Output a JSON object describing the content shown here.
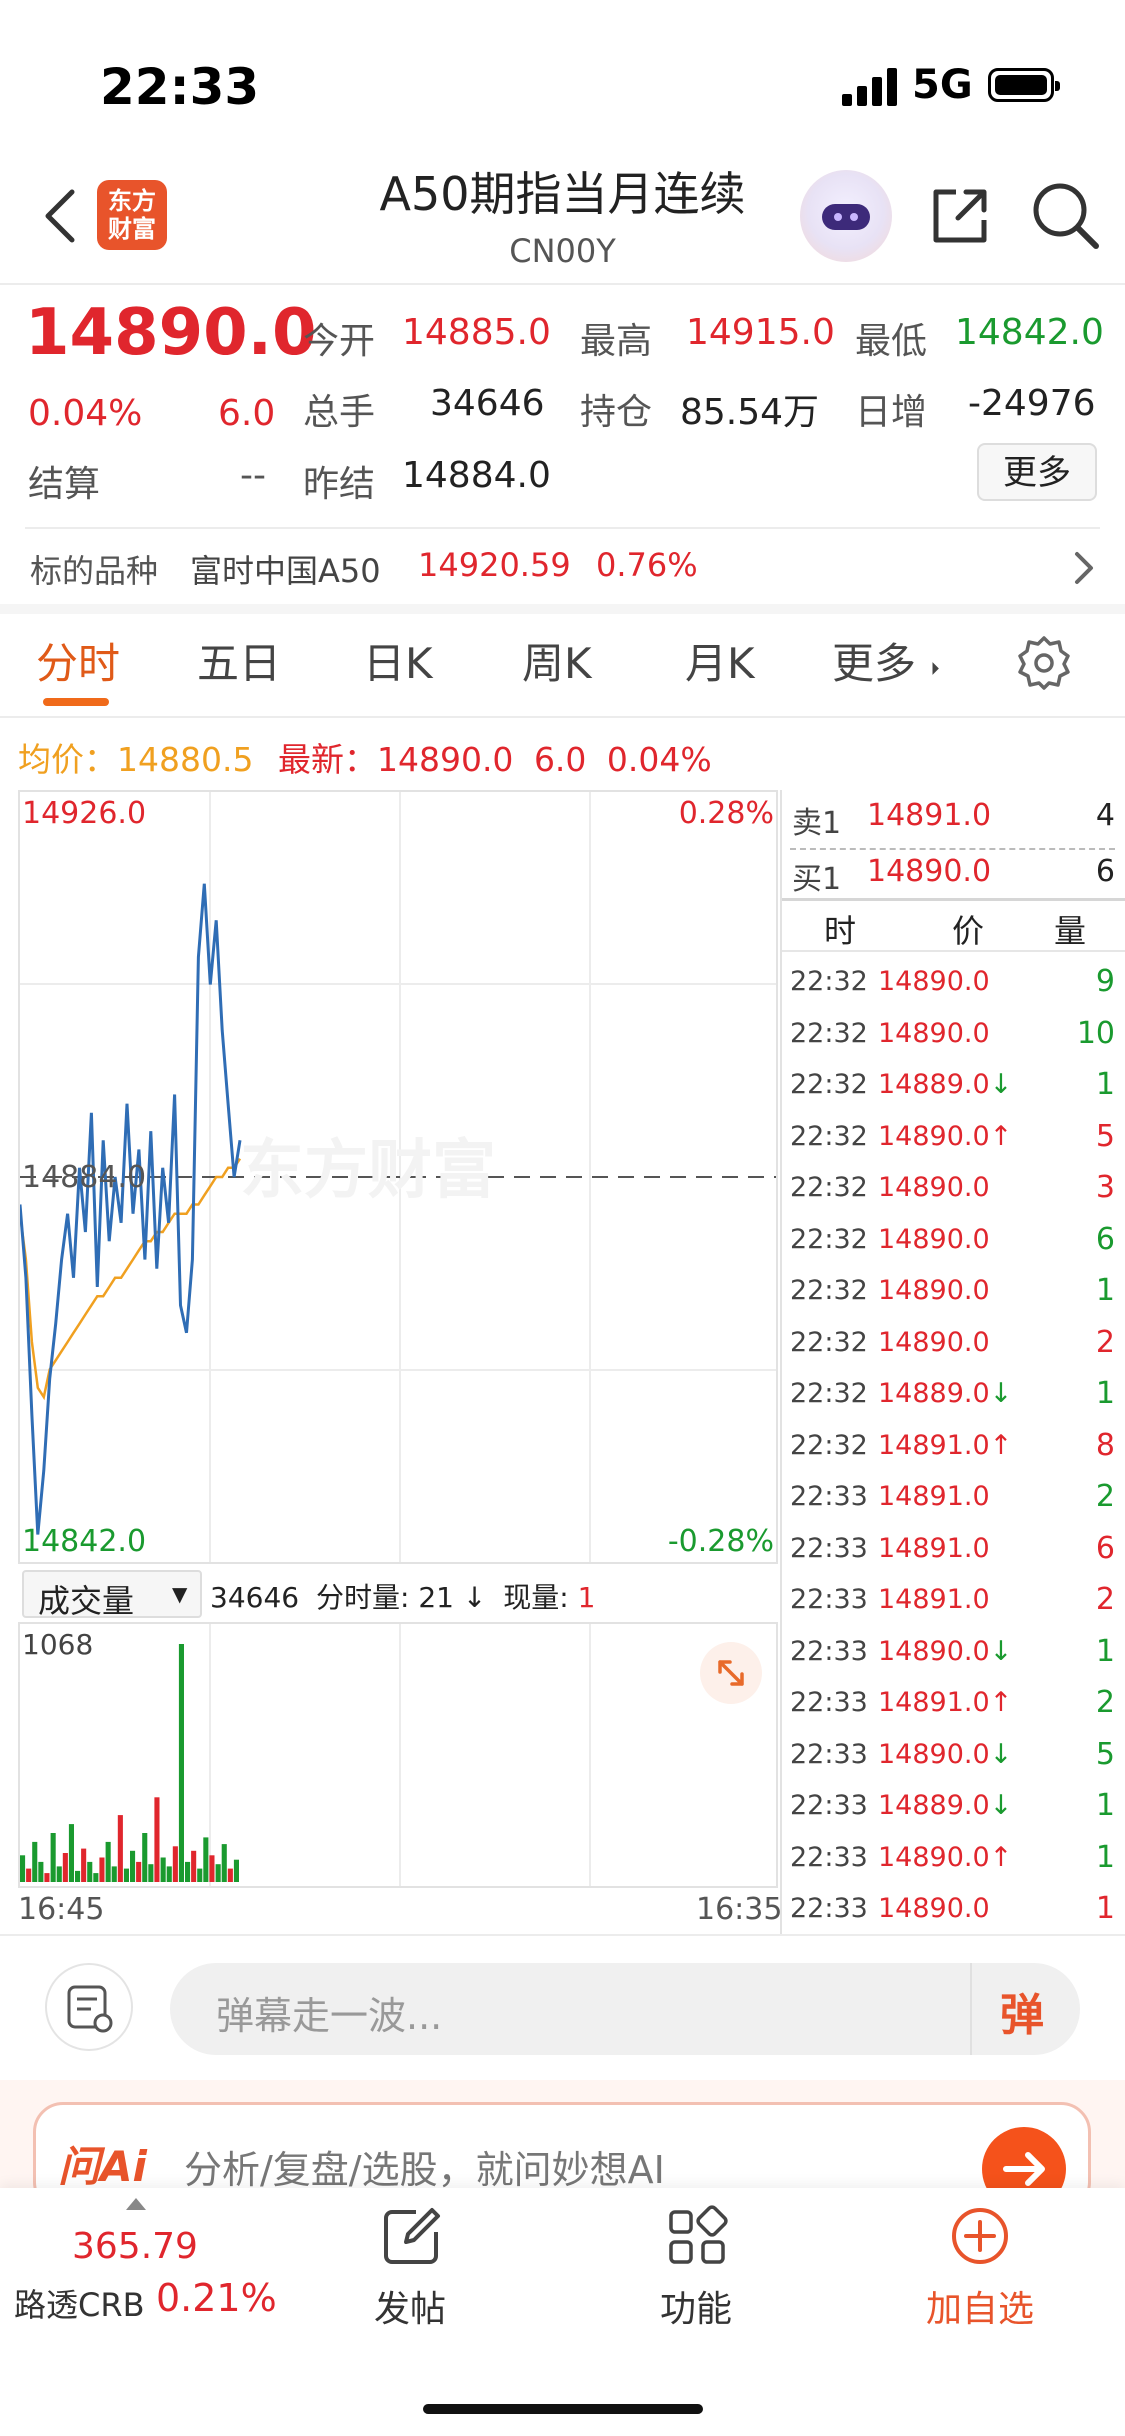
{
  "status_bar": {
    "time": "22:33",
    "network": "5G"
  },
  "header": {
    "logo_text": "东方财富",
    "title": "A50期指当月连续",
    "code": "CN00Y"
  },
  "quote": {
    "price": "14890.0",
    "change_pct": "0.04%",
    "change": "6.0",
    "fields": [
      {
        "label": "今开",
        "value": "14885.0"
      },
      {
        "label": "最高",
        "value": "14915.0"
      },
      {
        "label": "最低",
        "value": "14842.0"
      },
      {
        "label": "总手",
        "value": "34646"
      },
      {
        "label": "持仓",
        "value": "85.54万"
      },
      {
        "label": "日增",
        "value": "-24976"
      },
      {
        "label": "结算",
        "value": "--"
      },
      {
        "label": "昨结",
        "value": "14884.0"
      }
    ],
    "more_button": "更多"
  },
  "underlying": {
    "label": "标的品种",
    "name": "富时中国A50",
    "price": "14920.59",
    "pct": "0.76%"
  },
  "tabs": [
    "分时",
    "五日",
    "日K",
    "周K",
    "月K",
    "更多"
  ],
  "avg_line": {
    "avg_label": "均价：",
    "avg_value": "14880.5",
    "latest_label": "最新：",
    "latest_value": "14890.0",
    "change": "6.0",
    "pct": "0.04%"
  },
  "chart_data": {
    "type": "line",
    "ylim": [
      14842.0,
      14926.0
    ],
    "y_top_label": "14926.0",
    "y_bottom_label": "14842.0",
    "y_mid_label": "14884.0",
    "pct_top": "0.28%",
    "pct_bottom": "-0.28%",
    "x_start_label": "16:45",
    "x_end_label": "16:35",
    "watermark": "东方财富",
    "series": [
      {
        "values": [
          14881,
          14873,
          14858,
          14845,
          14852,
          14862,
          14868,
          14875,
          14880,
          14873,
          14885,
          14878,
          14891,
          14872,
          14888,
          14877,
          14884,
          14879,
          14892,
          14880,
          14887,
          14875,
          14889,
          14874,
          14885,
          14879,
          14893,
          14870,
          14867,
          14875,
          14908,
          14916,
          14905,
          14912,
          14900,
          14892,
          14884,
          14888
        ]
      },
      {
        "values": [
          14880,
          14875,
          14866,
          14861,
          14860,
          14863,
          14864,
          14865,
          14866,
          14867,
          14868,
          14869,
          14870,
          14871,
          14871,
          14872,
          14873,
          14873,
          14874,
          14875,
          14876,
          14877,
          14877,
          14878,
          14878,
          14879,
          14880,
          14880,
          14880,
          14881,
          14881,
          14882,
          14883,
          14884,
          14884,
          14885,
          14885,
          14886
        ]
      }
    ]
  },
  "order_book": {
    "sell_label": "卖1",
    "sell_price": "14891.0",
    "sell_qty": "4",
    "buy_label": "买1",
    "buy_price": "14890.0",
    "buy_qty": "6"
  },
  "ticks": {
    "headers": [
      "时",
      "价",
      "量"
    ],
    "rows": [
      {
        "time": "22:32",
        "price": "14890.0",
        "arrow": "",
        "qty": "9",
        "qty_color": "green"
      },
      {
        "time": "22:32",
        "price": "14890.0",
        "arrow": "",
        "qty": "10",
        "qty_color": "green"
      },
      {
        "time": "22:32",
        "price": "14889.0",
        "arrow": "↓",
        "qty": "1",
        "qty_color": "green"
      },
      {
        "time": "22:32",
        "price": "14890.0",
        "arrow": "↑",
        "qty": "5",
        "qty_color": "red"
      },
      {
        "time": "22:32",
        "price": "14890.0",
        "arrow": "",
        "qty": "3",
        "qty_color": "red"
      },
      {
        "time": "22:32",
        "price": "14890.0",
        "arrow": "",
        "qty": "6",
        "qty_color": "green"
      },
      {
        "time": "22:32",
        "price": "14890.0",
        "arrow": "",
        "qty": "1",
        "qty_color": "green"
      },
      {
        "time": "22:32",
        "price": "14890.0",
        "arrow": "",
        "qty": "2",
        "qty_color": "red"
      },
      {
        "time": "22:32",
        "price": "14889.0",
        "arrow": "↓",
        "qty": "1",
        "qty_color": "green"
      },
      {
        "time": "22:32",
        "price": "14891.0",
        "arrow": "↑",
        "qty": "8",
        "qty_color": "red"
      },
      {
        "time": "22:33",
        "price": "14891.0",
        "arrow": "",
        "qty": "2",
        "qty_color": "green"
      },
      {
        "time": "22:33",
        "price": "14891.0",
        "arrow": "",
        "qty": "6",
        "qty_color": "red"
      },
      {
        "time": "22:33",
        "price": "14891.0",
        "arrow": "",
        "qty": "2",
        "qty_color": "red"
      },
      {
        "time": "22:33",
        "price": "14890.0",
        "arrow": "↓",
        "qty": "1",
        "qty_color": "green"
      },
      {
        "time": "22:33",
        "price": "14891.0",
        "arrow": "↑",
        "qty": "2",
        "qty_color": "green"
      },
      {
        "time": "22:33",
        "price": "14890.0",
        "arrow": "↓",
        "qty": "5",
        "qty_color": "green"
      },
      {
        "time": "22:33",
        "price": "14889.0",
        "arrow": "↓",
        "qty": "1",
        "qty_color": "green"
      },
      {
        "time": "22:33",
        "price": "14890.0",
        "arrow": "↑",
        "qty": "1",
        "qty_color": "green"
      },
      {
        "time": "22:33",
        "price": "14890.0",
        "arrow": "",
        "qty": "1",
        "qty_color": "red"
      }
    ]
  },
  "volume": {
    "selector": "成交量",
    "total": "34646",
    "minute_label": "分时量:",
    "minute_value": "21 ↓",
    "now_label": "现量:",
    "now_value": "1",
    "max_label": "1068",
    "bars": [
      120,
      60,
      180,
      90,
      40,
      220,
      70,
      130,
      260,
      50,
      150,
      90,
      40,
      110,
      180,
      70,
      300,
      60,
      140,
      90,
      220,
      80,
      380,
      110,
      70,
      160,
      1068,
      90,
      140,
      60,
      200,
      120,
      80,
      170,
      60,
      100
    ]
  },
  "comment": {
    "placeholder": "弹幕走一波...",
    "danmu_button": "弹"
  },
  "ai": {
    "logo": "问Ai",
    "placeholder": "分析/复盘/选股，就问妙想AI"
  },
  "bottom_bar": {
    "ticker_value": "365.79",
    "ticker_name": "路透CRB",
    "ticker_pct": "0.21%",
    "items": [
      "发帖",
      "功能",
      "加自选"
    ]
  },
  "colors": {
    "up": "#e0262d",
    "down": "#1a9a2f",
    "accent": "#f06a1a",
    "price_line": "#2f6db5",
    "avg_line": "#f0a020"
  }
}
